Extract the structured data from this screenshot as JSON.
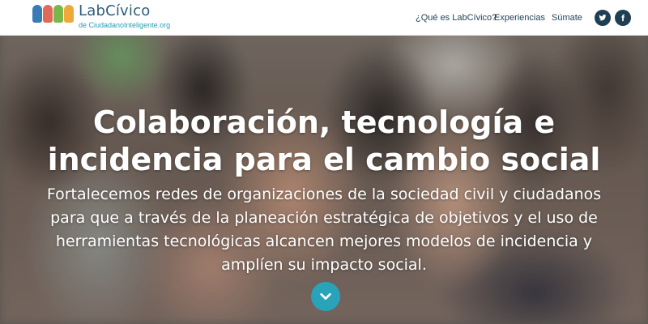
{
  "brand": {
    "name": "LabCívico",
    "subtitle": "de CiudadanoInteligente.org",
    "hand_colors": [
      "#3a7bb5",
      "#e06a5a",
      "#7ab648",
      "#f0a83c"
    ]
  },
  "nav": {
    "items": [
      {
        "label": "¿Qué es LabCívico?"
      },
      {
        "label": "Experiencias"
      },
      {
        "label": "Súmate"
      }
    ]
  },
  "social": [
    {
      "icon": "twitter-icon"
    },
    {
      "icon": "facebook-icon"
    }
  ],
  "hero": {
    "title": "Colaboración, tecnología e incidencia para el cambio social",
    "body": "Fortalecemos redes de organizaciones de la sociedad civil y ciudadanos para que a través de la planeación estratégica de objetivos y el uso de herramientas tecnológicas alcancen mejores modelos de incidencia y amplíen su impacto social.",
    "scroll_icon": "chevron-down-icon"
  },
  "colors": {
    "accent": "#29a3ba",
    "nav_text": "#1f3f54",
    "logo_text": "#2d5d7a",
    "logo_sub": "#27a0b7"
  }
}
